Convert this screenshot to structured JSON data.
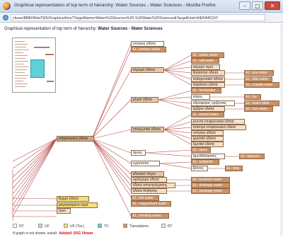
{
  "window": {
    "title": "Graphical representation of top term of hierarchy: Water Sources - Water Sciences - Mozilla Firefox",
    "minimize": "–",
    "maximize": "□",
    "close": "✕"
  },
  "address_bar": {
    "url": "cbone/8880/WebTMS/Graphical/tms?TargetName=Water%20Sources%20-%20Water%20Sciences&TargetKind=HIERARCHY"
  },
  "heading": {
    "prefix": "Graphical representation of top term of hierarchy: ",
    "term": "Water Sources - Water Sciences"
  },
  "tree": {
    "root_label": "επιφανειακά ύδατα",
    "nodes": [
      {
        "id": "n1",
        "label": "υπόγεια ύδατα",
        "kind": "nt"
      },
      {
        "id": "n2",
        "label": "EL: surface water",
        "kind": "tr"
      },
      {
        "id": "n3",
        "label": "EL: saline water",
        "kind": "tr"
      },
      {
        "id": "n4",
        "label": "EL: salt water",
        "kind": "tr"
      },
      {
        "id": "n5",
        "label": "αλμυρό νερό",
        "kind": "ufa"
      },
      {
        "id": "n6",
        "label": "αλμυρά ύδατα",
        "kind": "ch"
      },
      {
        "id": "n7",
        "label": "θαλάσσιο ύδατα",
        "kind": "ufa"
      },
      {
        "id": "n8",
        "label": "EL: sea water",
        "kind": "tr"
      },
      {
        "id": "n9",
        "label": "παλιρροιακά ύδατα",
        "kind": "ufa"
      },
      {
        "id": "n10",
        "label": "EL: tidal water",
        "kind": "tr"
      },
      {
        "id": "n11",
        "label": "παράκτια ύδατα",
        "kind": "ufa"
      },
      {
        "id": "n12",
        "label": "EL: coastal water",
        "kind": "tr"
      },
      {
        "id": "n13",
        "label": "EL: freshwater",
        "kind": "tr"
      },
      {
        "id": "n14",
        "label": "γλυκά ύδατα",
        "kind": "ch"
      },
      {
        "id": "n15",
        "label": "πάγος",
        "kind": "nt"
      },
      {
        "id": "n16",
        "label": "EL: ice",
        "kind": "tr"
      },
      {
        "id": "n17",
        "label": "υδροφόρος ορίζοντας",
        "kind": "nt"
      },
      {
        "id": "n18",
        "label": "EL: water table",
        "kind": "tr"
      },
      {
        "id": "n19",
        "label": "όμβριο ύδατα",
        "kind": "ufa"
      },
      {
        "id": "n20",
        "label": "EL: rain water",
        "kind": "tr"
      },
      {
        "id": "n21",
        "label": "EL: inland water",
        "kind": "tr"
      },
      {
        "id": "n22",
        "label": "ρέοντα επιφανειακά ύδατα",
        "kind": "ufa"
      },
      {
        "id": "n23",
        "label": "στάσιμα επιφανειακά ύδατα",
        "kind": "ufa"
      },
      {
        "id": "n24",
        "label": "ηπειρωτικά ύδατα",
        "kind": "ch"
      },
      {
        "id": "n25",
        "label": "υπόγεια ύδατα",
        "kind": "ufa"
      },
      {
        "id": "n26",
        "label": "χερσαία ύδατα",
        "kind": "ufa"
      },
      {
        "id": "n27",
        "label": "λιμναία ύδατα",
        "kind": "ufa"
      },
      {
        "id": "n28",
        "label": "EL: lakes",
        "kind": "tr"
      },
      {
        "id": "n29",
        "label": "λίμνες",
        "kind": "nt"
      },
      {
        "id": "n30",
        "label": "λιμνοθάλασσες",
        "kind": "nt"
      },
      {
        "id": "n31",
        "label": "EL: lagoons",
        "kind": "tr"
      },
      {
        "id": "n32",
        "label": "EL: wetlands",
        "kind": "tr"
      },
      {
        "id": "n33",
        "label": "υγρότοποι",
        "kind": "nt"
      },
      {
        "id": "n34",
        "label": "βάλτος",
        "kind": "nt"
      },
      {
        "id": "n35",
        "label": "EL: bog",
        "kind": "tr"
      },
      {
        "id": "n36",
        "label": "υδατικοί πόροι",
        "kind": "ch"
      },
      {
        "id": "n37",
        "label": "υφάλμυρα ύδατα",
        "kind": "ufa"
      },
      {
        "id": "n38",
        "label": "EL: brackish water",
        "kind": "tr"
      },
      {
        "id": "n39",
        "label": "ύδατα αποστράγγισης",
        "kind": "ufa"
      },
      {
        "id": "n40",
        "label": "EL: drainage water",
        "kind": "tr"
      },
      {
        "id": "n41",
        "label": "ύδατα διήθησης",
        "kind": "ufa"
      },
      {
        "id": "n42",
        "label": "EL: seepage water",
        "kind": "tr"
      },
      {
        "id": "n43",
        "label": "θερμά ύδατα",
        "kind": "uf"
      },
      {
        "id": "n44",
        "label": "EL: hot water",
        "kind": "tr"
      },
      {
        "id": "n45",
        "label": "μαγνητισμένο νερό",
        "kind": "uf"
      },
      {
        "id": "n46",
        "label": "EL: magnetized water",
        "kind": "tr"
      },
      {
        "id": "n47",
        "label": "νερό",
        "kind": "ufa"
      },
      {
        "id": "n48",
        "label": "EL: drinking water",
        "kind": "tr"
      }
    ]
  },
  "legend": {
    "items": [
      {
        "label": "NT",
        "color": "#ffffff"
      },
      {
        "label": "UF",
        "color": "#f9c0c8"
      },
      {
        "label": "UF (Tra.)",
        "color": "#f6e078"
      },
      {
        "label": "TC",
        "color": "#5fd0d8"
      },
      {
        "label": "Translations",
        "color": "#cc9166"
      },
      {
        "label": "RT",
        "color": "#e6e6e6"
      }
    ]
  },
  "note": {
    "text": "If graph is not shown, install:",
    "link": "Adobe® SVG Viewer"
  }
}
